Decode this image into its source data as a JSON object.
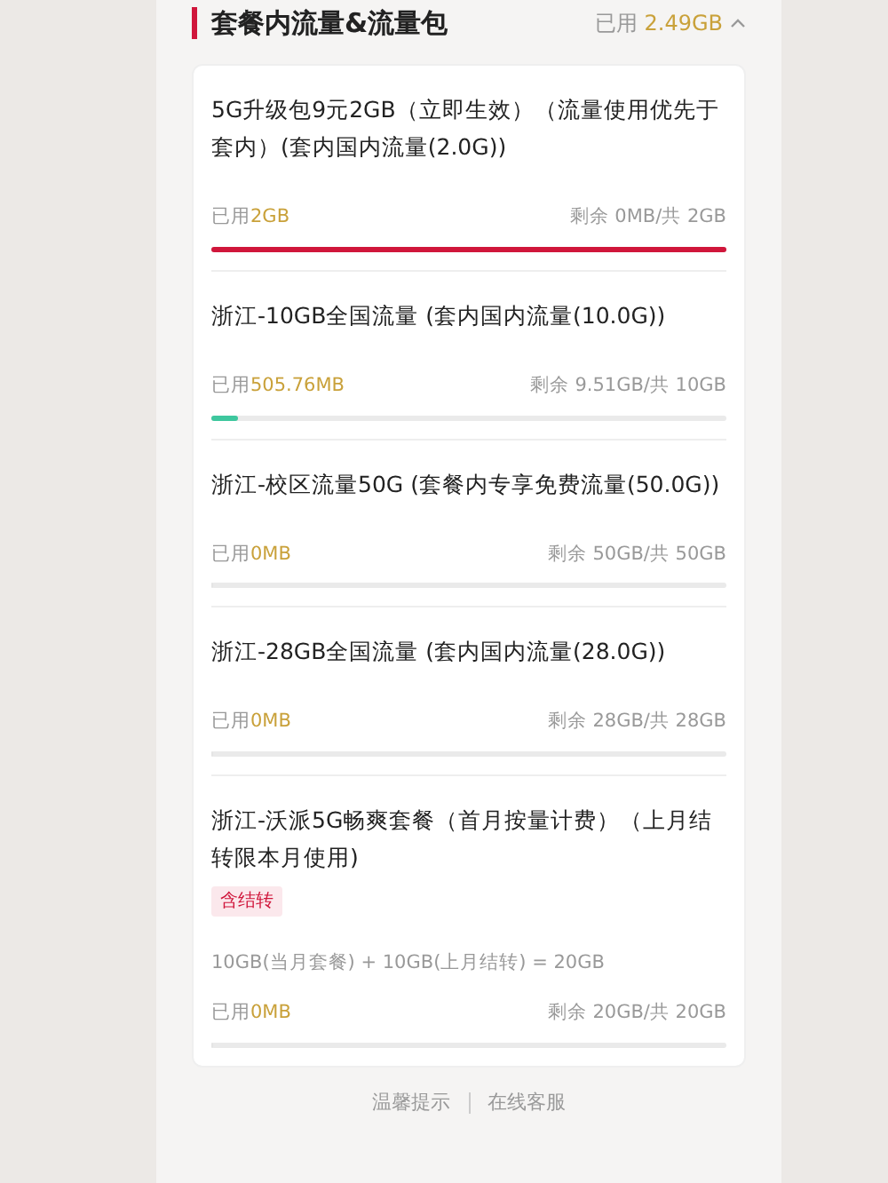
{
  "section": {
    "title": "套餐内流量&流量包",
    "used_label": "已用",
    "used_value": "2.49GB",
    "expanded": true
  },
  "packages": [
    {
      "title": "5G升级包9元2GB（立即生效）（流量使用优先于套内）(套内国内流量(2.0G))",
      "used_label": "已用",
      "used_value": "2GB",
      "remaining": "剩余 0MB/共 2GB",
      "level": 1,
      "color": "#d0163b"
    },
    {
      "title": "浙江-10GB全国流量 (套内国内流量(10.0G))",
      "used_label": "已用",
      "used_value": "505.76MB",
      "remaining": "剩余 9.51GB/共 10GB",
      "level": 0.05,
      "color": "#3ec79e"
    },
    {
      "title": "浙江-校区流量50G (套餐内专享免费流量(50.0G))",
      "used_label": "已用",
      "used_value": "0MB",
      "remaining": "剩余 50GB/共 50GB",
      "level": 0
    },
    {
      "title": "浙江-28GB全国流量 (套内国内流量(28.0G))",
      "used_label": "已用",
      "used_value": "0MB",
      "remaining": "剩余 28GB/共 28GB",
      "level": 0
    },
    {
      "title": "浙江-沃派5G畅爽套餐（首月按量计费）（上月结转限本月使用)",
      "tag": "含结转",
      "note": "10GB(当月套餐) + 10GB(上月结转) = 20GB",
      "used_label": "已用",
      "used_value": "0MB",
      "remaining": "剩余 20GB/共 20GB",
      "level": 0
    }
  ],
  "footer_links": [
    "温馨提示",
    "在线客服"
  ]
}
